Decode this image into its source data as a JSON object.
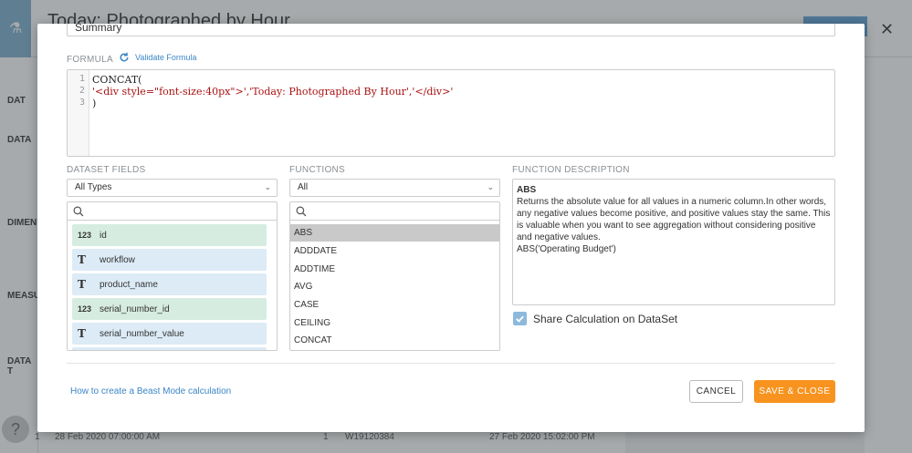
{
  "background": {
    "title": "Today: Photographed by Hour",
    "sidebar_labels": [
      "DAT",
      "DATA",
      "DIMEN",
      "MEASU",
      "DATA T"
    ],
    "bottom_row": {
      "row_number": "1",
      "col1": "28 Feb 2020 07:00:00 AM",
      "col2": "1",
      "col3": "W19120384",
      "col4": "27 Feb 2020 15:02:00 PM"
    },
    "help_glyph": "?"
  },
  "modal": {
    "name_value": "Summary",
    "formula_label": "FORMULA",
    "validate_label": "Validate Formula",
    "code_lines": [
      {
        "num": "1",
        "text": "CONCAT("
      },
      {
        "num": "2",
        "text": "'<div style=\"font-size:40px\">','Today: Photographed By Hour','</div>'"
      },
      {
        "num": "3",
        "text": ")"
      }
    ],
    "dataset_fields": {
      "label": "DATASET FIELDS",
      "type_filter": "All Types",
      "items": [
        {
          "type": "123",
          "name": "id",
          "kind": "number"
        },
        {
          "type": "T",
          "name": "workflow",
          "kind": "text"
        },
        {
          "type": "T",
          "name": "product_name",
          "kind": "text"
        },
        {
          "type": "123",
          "name": "serial_number_id",
          "kind": "number"
        },
        {
          "type": "T",
          "name": "serial_number_value",
          "kind": "text"
        }
      ]
    },
    "functions": {
      "label": "FUNCTIONS",
      "filter": "All",
      "items": [
        "ABS",
        "ADDDATE",
        "ADDTIME",
        "AVG",
        "CASE",
        "CEILING",
        "CONCAT"
      ],
      "selected": "ABS"
    },
    "function_description": {
      "label": "FUNCTION DESCRIPTION",
      "title": "ABS",
      "body": "Returns the absolute value for all values in a numeric column.In other words, any negative values become positive, and positive values stay the same. This is valuable when you want to see aggregation without considering positive and negative values.",
      "example": "ABS('Operating Budget')"
    },
    "share_label": "Share Calculation on DataSet",
    "share_checked": true,
    "help_link": "How to create a Beast Mode calculation",
    "cancel_label": "CANCEL",
    "save_label": "SAVE & CLOSE"
  },
  "colors": {
    "accent_orange": "#f7931e",
    "link_blue": "#3b86c6",
    "number_field_bg": "#d6ece1",
    "text_field_bg": "#dcebf6"
  }
}
